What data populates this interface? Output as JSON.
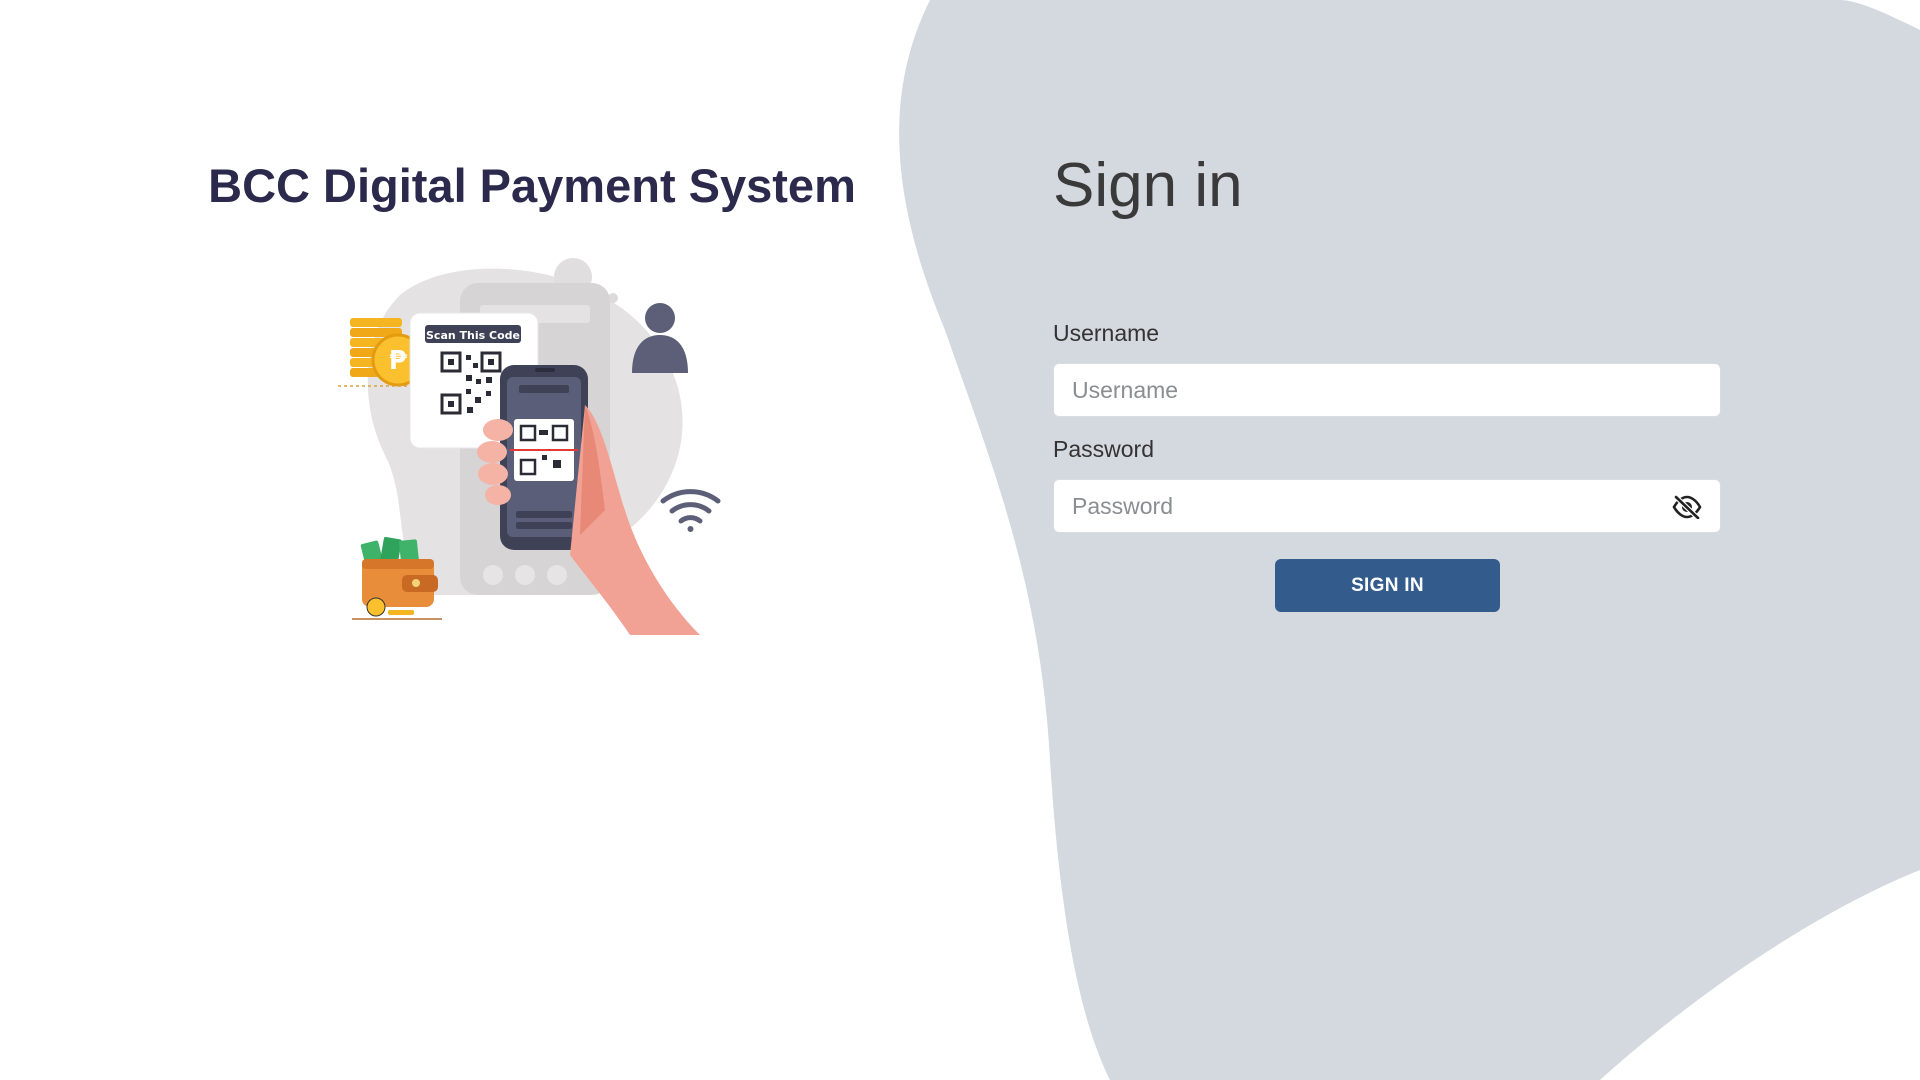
{
  "brand": {
    "title": "BCC Digital Payment System"
  },
  "illustration": {
    "card_text": "Scan This Code",
    "icons": [
      "coin-stack-icon",
      "qr-code-icon",
      "phone-icon",
      "hand-icon",
      "user-icon",
      "wifi-icon",
      "wallet-icon"
    ]
  },
  "signin": {
    "heading": "Sign in",
    "username_label": "Username",
    "username_placeholder": "Username",
    "username_value": "",
    "password_label": "Password",
    "password_placeholder": "Password",
    "password_value": "",
    "password_toggle_icon": "eye-slash-icon",
    "submit_label": "SIGN IN"
  },
  "colors": {
    "background_blob": "#d4d8df",
    "title": "#2b2a4c",
    "button": "#335c8c"
  }
}
